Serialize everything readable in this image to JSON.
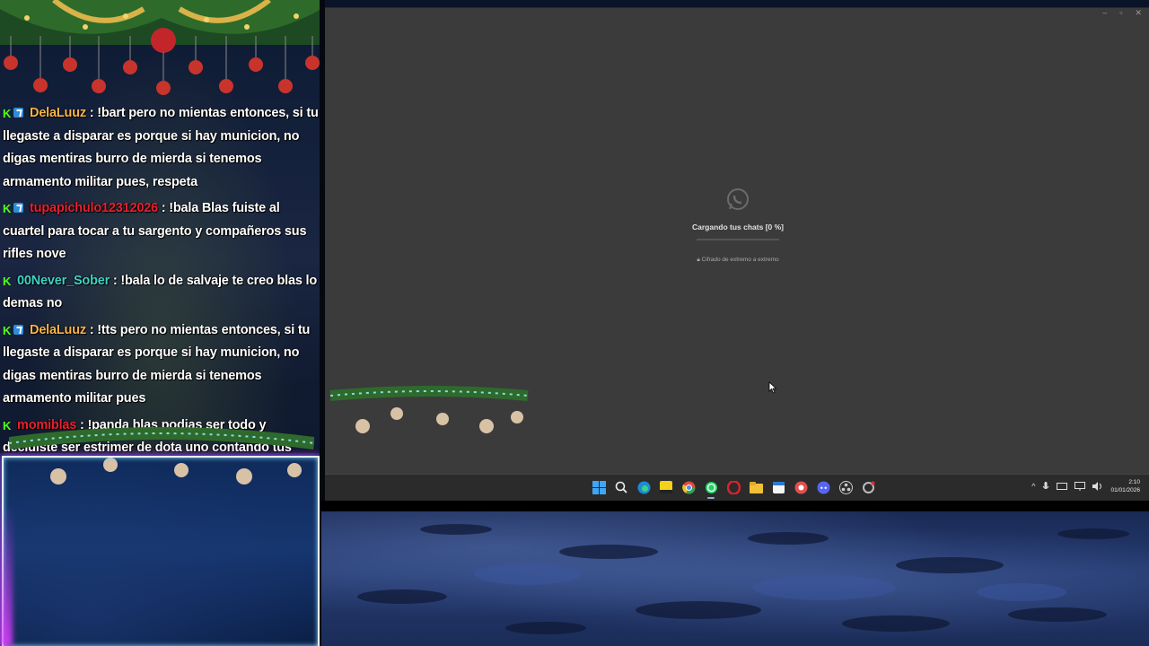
{
  "chat": {
    "messages": [
      {
        "badges": [
          "kick",
          "sub"
        ],
        "user": "DelaLuuz",
        "user_color": "#f7b54a",
        "text": "!bart pero no mientas entonces, si tu llegaste a disparar es porque si hay municion, no digas mentiras burro de mierda si tenemos armamento militar pues, respeta"
      },
      {
        "badges": [
          "kick",
          "sub"
        ],
        "user": "tupapichulo12312026",
        "user_color": "#e8202f",
        "text": "!bala Blas fuiste al cuartel para tocar a tu sargento y compañeros sus rifles nove"
      },
      {
        "badges": [
          "kick"
        ],
        "user": "00Never_Sober",
        "user_color": "#3fd2c7",
        "text": "!bala lo de salvaje te creo blas lo demas no"
      },
      {
        "badges": [
          "kick",
          "sub"
        ],
        "user": "DelaLuuz",
        "user_color": "#f7b54a",
        "text": "!tts pero no mientas entonces, si tu llegaste a disparar es porque si hay municion, no digas mentiras burro de mierda si tenemos armamento militar pues"
      },
      {
        "badges": [
          "kick"
        ],
        "user": "momiblas",
        "user_color": "#e8202f",
        "text": "!panda blas podias ser todo y decidiste ser estrimer de dota uno contando tus anecdotas de hace quince años"
      }
    ]
  },
  "whatsapp": {
    "loading_text": "Cargando tus chats [0 %]",
    "progress_percent": 0,
    "encrypted_text": "Cifrado de extremo a extremo"
  },
  "window_controls": [
    "–",
    "▫",
    "✕"
  ],
  "taskbar": {
    "icons": [
      "start-icon",
      "search-icon",
      "edge-icon",
      "sticky-notes-icon",
      "chrome-icon",
      "whatsapp-icon",
      "opera-icon",
      "file-explorer-icon",
      "calendar-icon",
      "app-icon",
      "discord-icon",
      "obs-icon",
      "settings-icon"
    ],
    "active": "whatsapp-icon",
    "clock_time": "2:10",
    "clock_date": "01/01/2026"
  },
  "colors": {
    "window_bg": "#3b3b3b",
    "taskbar_bg": "#2b2b2b",
    "kick_green": "#53fc18"
  }
}
